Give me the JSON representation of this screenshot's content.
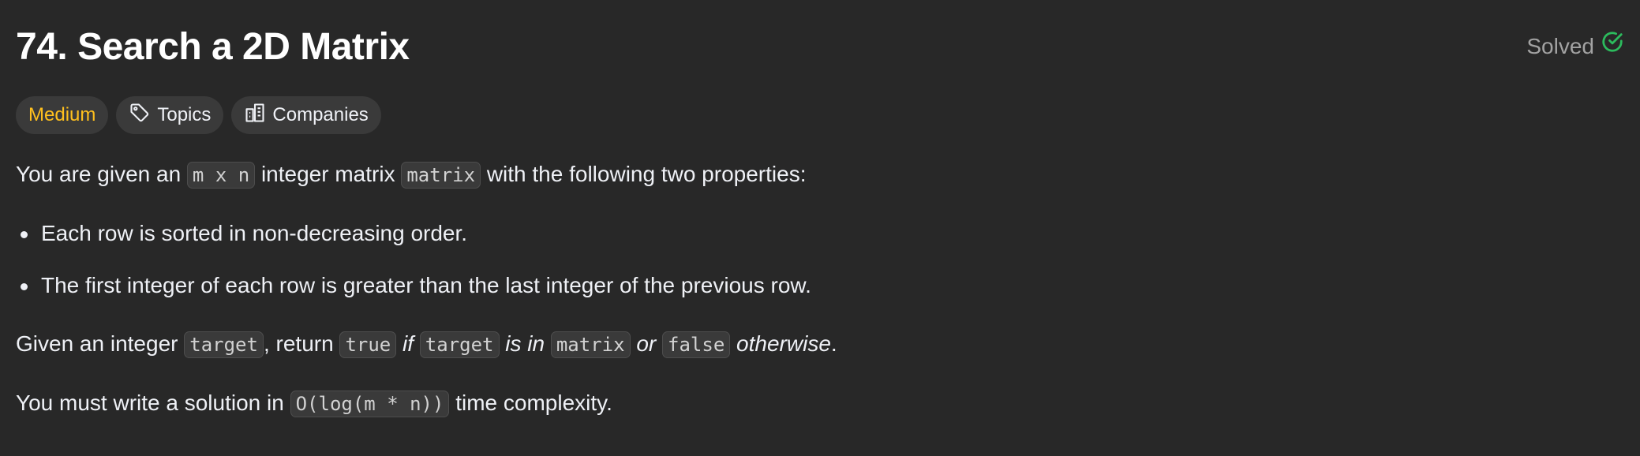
{
  "problem": {
    "title": "74. Search a 2D Matrix",
    "status": "Solved"
  },
  "tags": {
    "difficulty": "Medium",
    "topics": "Topics",
    "companies": "Companies"
  },
  "description": {
    "p1": {
      "t1": "You are given an ",
      "c1": "m x n",
      "t2": " integer matrix ",
      "c2": "matrix",
      "t3": " with the following two properties:"
    },
    "bullets": [
      "Each row is sorted in non-decreasing order.",
      "The first integer of each row is greater than the last integer of the previous row."
    ],
    "p2": {
      "t1": "Given an integer ",
      "c1": "target",
      "t2": ", return ",
      "c2": "true",
      "e1": " if ",
      "c3": "target",
      "e2": " is in ",
      "c4": "matrix",
      "e3": " or ",
      "c5": "false",
      "e4": " otherwise",
      "t3": "."
    },
    "p3": {
      "t1": "You must write a solution in ",
      "c1": "O(log(m * n))",
      "t2": " time complexity."
    }
  },
  "colors": {
    "background": "#282828",
    "difficulty_medium": "#ffc01e",
    "solved_check": "#2cbb5d"
  },
  "icons": {
    "solved": "check-circle-icon",
    "topics": "tag-icon",
    "companies": "building-icon"
  }
}
